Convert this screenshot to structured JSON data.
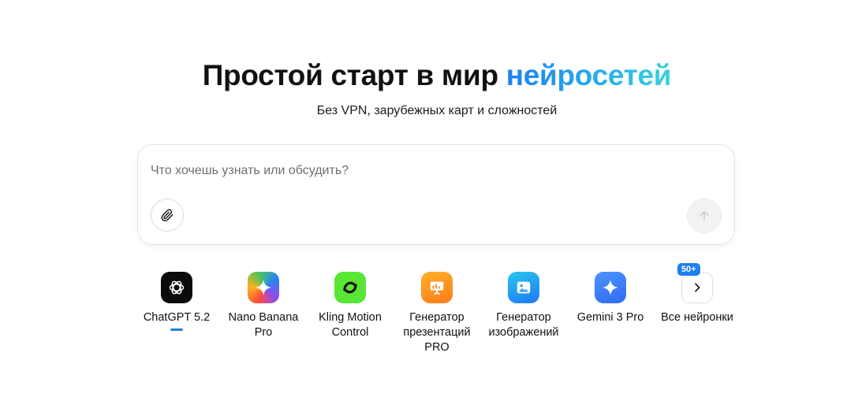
{
  "hero": {
    "title_main": "Простой старт в мир ",
    "title_accent": "нейросетей",
    "subtitle": "Без VPN, зарубежных карт и сложностей"
  },
  "prompt": {
    "placeholder": "Что хочешь узнать или обсудить?",
    "value": ""
  },
  "colors": {
    "accent": "#1e7ff0",
    "accent_end": "#3ad0df"
  },
  "models": [
    {
      "label": "ChatGPT 5.2",
      "icon": "openai-logo-icon",
      "active": true
    },
    {
      "label": "Nano Banana Pro",
      "icon": "sparkle-icon"
    },
    {
      "label": "Kling Motion Control",
      "icon": "kling-logo-icon"
    },
    {
      "label": "Генератор презентаций PRO",
      "icon": "presentation-icon"
    },
    {
      "label": "Генератор изображений",
      "icon": "image-icon"
    },
    {
      "label": "Gemini 3 Pro",
      "icon": "gemini-sparkle-icon"
    },
    {
      "label": "Все нейронки",
      "icon": "chevron-right-icon",
      "badge": "50+"
    }
  ]
}
